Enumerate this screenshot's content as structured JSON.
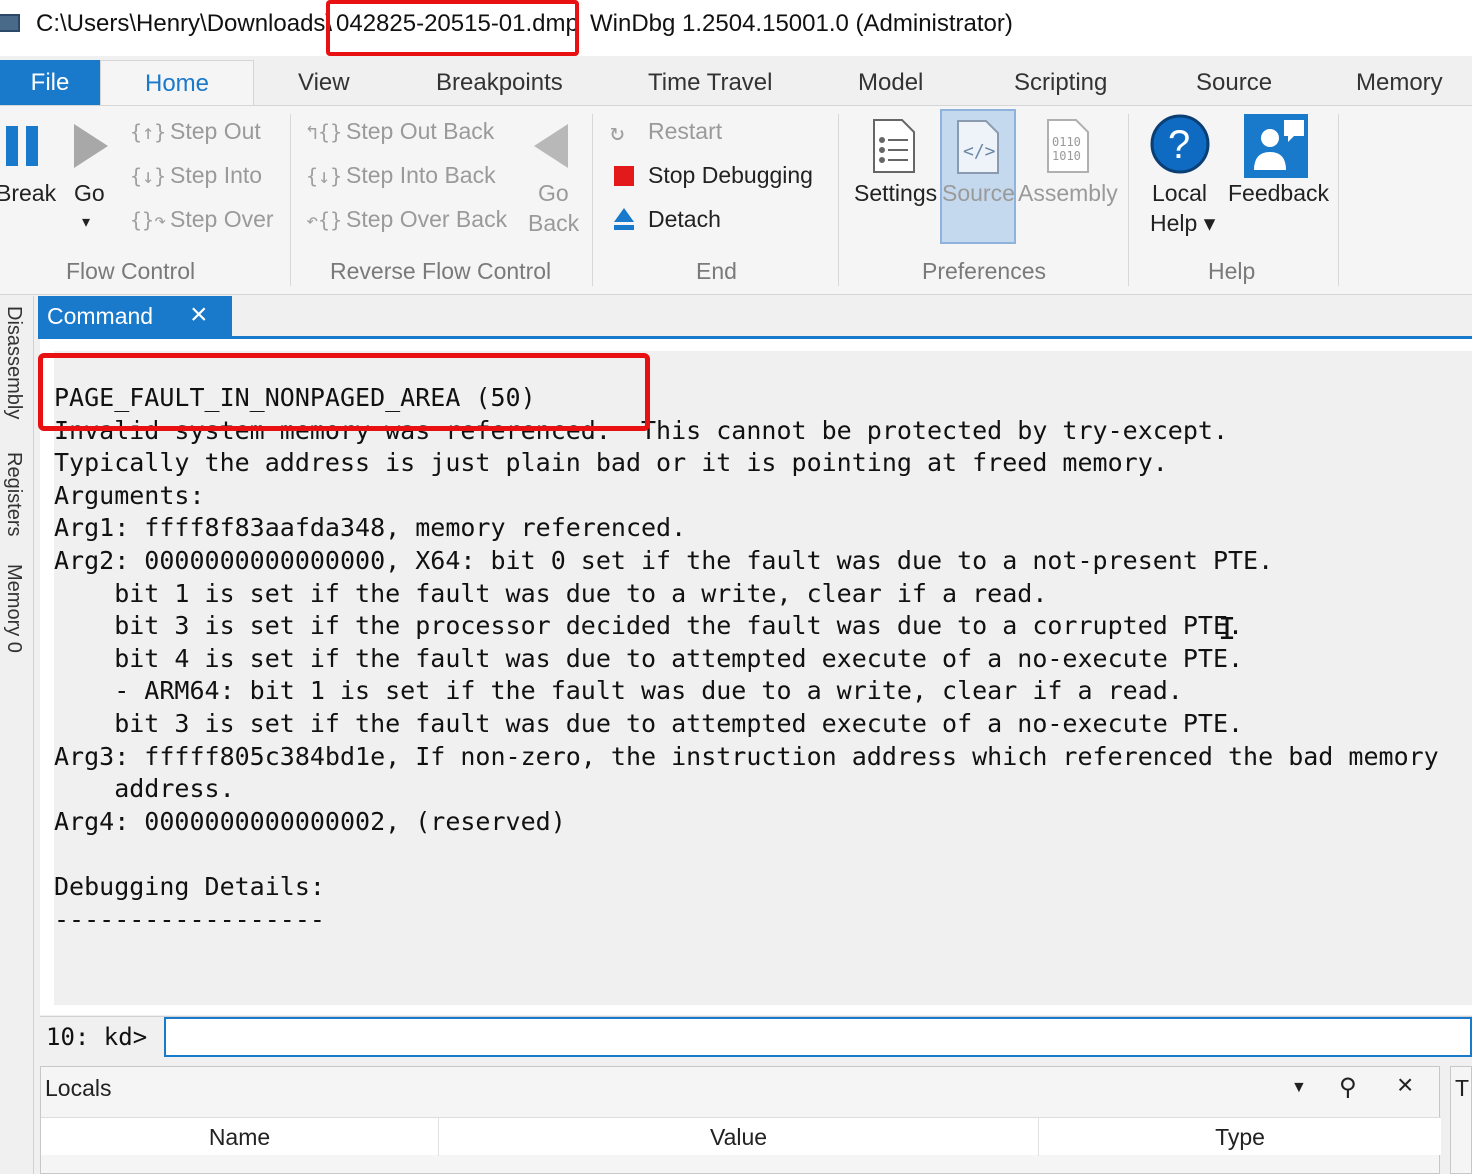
{
  "titlebar": {
    "path": "C:\\Users\\Henry\\Downloads\\",
    "file": "042825-20515-01.dmp",
    "app": "WinDbg 1.2504.15001.0 (Administrator)"
  },
  "tabs": [
    "File",
    "Home",
    "View",
    "Breakpoints",
    "Time Travel",
    "Model",
    "Scripting",
    "Source",
    "Memory"
  ],
  "ribbon": {
    "flow_control": {
      "label": "Flow Control",
      "break": "Break",
      "go": "Go",
      "go_arrow": "▾",
      "step_out": "Step Out",
      "step_into": "Step Into",
      "step_over": "Step Over"
    },
    "reverse_flow": {
      "label": "Reverse Flow Control",
      "step_out_back": "Step Out Back",
      "step_into_back": "Step Into Back",
      "step_over_back": "Step Over Back",
      "go_back_1": "Go",
      "go_back_2": "Back"
    },
    "end": {
      "label": "End",
      "restart": "Restart",
      "stop": "Stop Debugging",
      "detach": "Detach"
    },
    "preferences": {
      "label": "Preferences",
      "settings": "Settings",
      "source": "Source",
      "assembly": "Assembly"
    },
    "help": {
      "label": "Help",
      "local_help_1": "Local",
      "local_help_2": "Help ▾",
      "feedback": "Feedback"
    }
  },
  "sidetabs": [
    "Disassembly",
    "Registers",
    "Memory 0"
  ],
  "command": {
    "tab_label": "Command",
    "output": "PAGE_FAULT_IN_NONPAGED_AREA (50)\nInvalid system memory was referenced.  This cannot be protected by try-except.\nTypically the address is just plain bad or it is pointing at freed memory.\nArguments:\nArg1: ffff8f83aafda348, memory referenced.\nArg2: 0000000000000000, X64: bit 0 set if the fault was due to a not-present PTE.\n    bit 1 is set if the fault was due to a write, clear if a read.\n    bit 3 is set if the processor decided the fault was due to a corrupted PTE.\n    bit 4 is set if the fault was due to attempted execute of a no-execute PTE.\n    - ARM64: bit 1 is set if the fault was due to a write, clear if a read.\n    bit 3 is set if the fault was due to attempted execute of a no-execute PTE.\nArg3: fffff805c384bd1e, If non-zero, the instruction address which referenced the bad memory\n    address.\nArg4: 0000000000000002, (reserved)\n\nDebugging Details:\n------------------",
    "prompt": "10: kd>",
    "input_value": ""
  },
  "locals": {
    "title": "Locals",
    "columns": [
      "Name",
      "Value",
      "Type"
    ]
  },
  "right_pane_label": "T",
  "colors": {
    "accent": "#1979ca",
    "highlight": "#e81010"
  }
}
